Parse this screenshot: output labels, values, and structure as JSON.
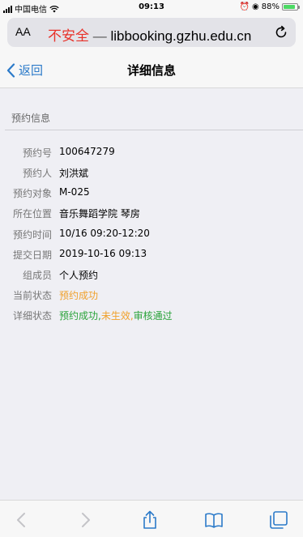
{
  "status_bar": {
    "carrier": "中国电信",
    "time": "09:13",
    "battery": "88%",
    "battery_level": 0.88
  },
  "url_bar": {
    "text_size_label": "AA",
    "security_label": "不安全",
    "separator": "—",
    "domain": "libbooking.gzhu.edu.cn"
  },
  "nav": {
    "back_label": "返回",
    "title": "详细信息"
  },
  "section": {
    "title": "预约信息"
  },
  "details": [
    {
      "label": "预约号",
      "value": "100647279"
    },
    {
      "label": "预约人",
      "value": "刘洪斌"
    },
    {
      "label": "预约对象",
      "value": "M-025"
    },
    {
      "label": "所在位置",
      "value": "音乐舞蹈学院 琴房"
    },
    {
      "label": "预约时间",
      "value": "10/16 09:20-12:20"
    },
    {
      "label": "提交日期",
      "value": "2019-10-16 09:13"
    },
    {
      "label": "组成员",
      "value": "个人预约"
    },
    {
      "label": "当前状态",
      "value": "预约成功"
    },
    {
      "label": "详细状态",
      "value_parts": [
        "预约成功,",
        "未生效,",
        "审核通过"
      ]
    }
  ],
  "colors": {
    "accent": "#2b7ac9",
    "status_orange": "#f0a12c",
    "status_green": "#2aa33a",
    "insecure_red": "#e8322a"
  },
  "toolbar_icons": [
    "back-arrow-icon",
    "forward-arrow-icon",
    "share-icon",
    "bookmarks-icon",
    "tabs-icon"
  ]
}
